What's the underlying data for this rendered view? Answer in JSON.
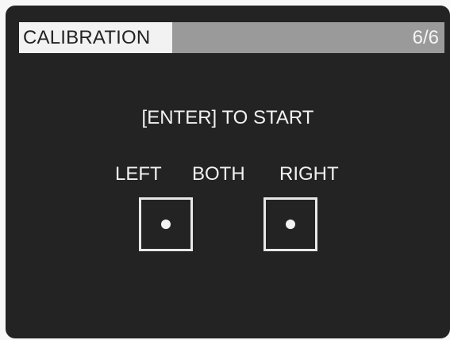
{
  "header": {
    "title": "CALIBRATION",
    "step": "6/6",
    "progress_fraction": 0.36
  },
  "instruction": "[ENTER] TO START",
  "channels": {
    "left": "LEFT",
    "both": "BOTH",
    "right": "RIGHT"
  },
  "colors": {
    "screen_background": "#232324",
    "title_bar_track": "#9a9a9a",
    "title_bar_fill": "#f2f2f2",
    "text": "#f2f2f2"
  }
}
